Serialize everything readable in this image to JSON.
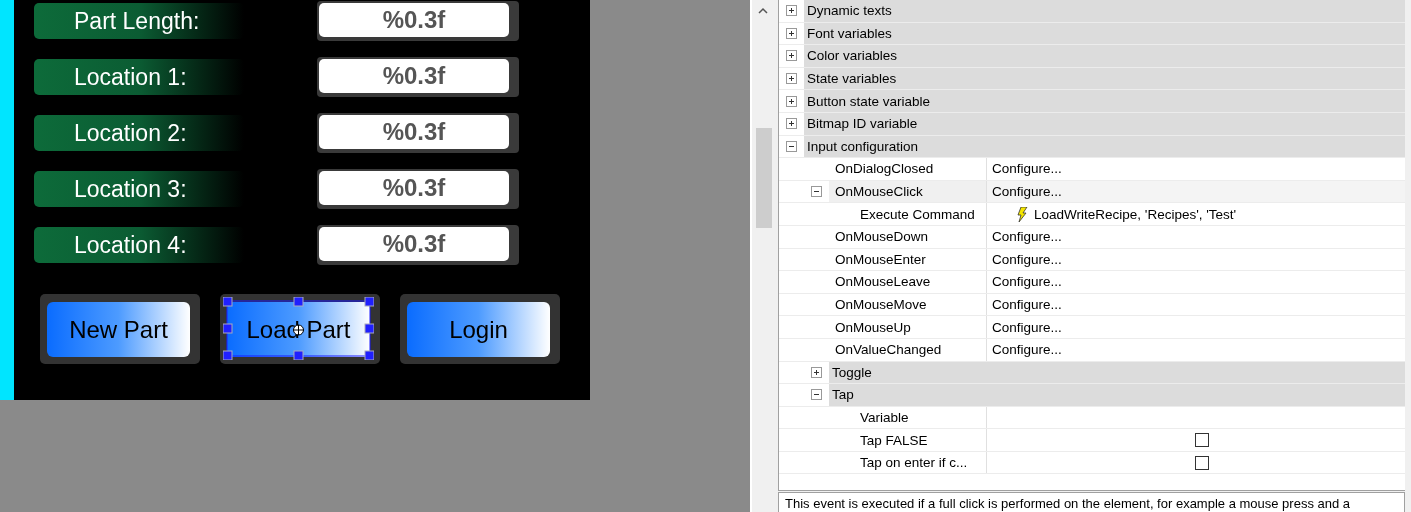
{
  "form": {
    "rows": [
      {
        "label": "Part Length:",
        "value": "%0.3f"
      },
      {
        "label": "Location 1:",
        "value": "%0.3f"
      },
      {
        "label": "Location 2:",
        "value": "%0.3f"
      },
      {
        "label": "Location 3:",
        "value": "%0.3f"
      },
      {
        "label": "Location 4:",
        "value": "%0.3f"
      }
    ],
    "buttons": [
      {
        "label": "New Part",
        "selected": false
      },
      {
        "label": "Load Part",
        "selected": true
      },
      {
        "label": "Login",
        "selected": false
      }
    ]
  },
  "properties": [
    {
      "kind": "category",
      "label": "Dynamic texts",
      "expanded": false
    },
    {
      "kind": "category",
      "label": "Font variables",
      "expanded": false
    },
    {
      "kind": "category",
      "label": "Color variables",
      "expanded": false
    },
    {
      "kind": "category",
      "label": "State variables",
      "expanded": false
    },
    {
      "kind": "category",
      "label": "Button state variable",
      "expanded": false
    },
    {
      "kind": "category",
      "label": "Bitmap ID variable",
      "expanded": false
    },
    {
      "kind": "category",
      "label": "Input configuration",
      "expanded": true,
      "children": [
        {
          "kind": "property",
          "name": "OnDialogClosed",
          "value": "Configure..."
        },
        {
          "kind": "property",
          "name": "OnMouseClick",
          "value": "Configure...",
          "expanded": true,
          "children": [
            {
              "kind": "command",
              "name": "Execute Command",
              "value": "LoadWriteRecipe, 'Recipes', 'Test'"
            }
          ]
        },
        {
          "kind": "property",
          "name": "OnMouseDown",
          "value": "Configure..."
        },
        {
          "kind": "property",
          "name": "OnMouseEnter",
          "value": "Configure..."
        },
        {
          "kind": "property",
          "name": "OnMouseLeave",
          "value": "Configure..."
        },
        {
          "kind": "property",
          "name": "OnMouseMove",
          "value": "Configure..."
        },
        {
          "kind": "property",
          "name": "OnMouseUp",
          "value": "Configure..."
        },
        {
          "kind": "property",
          "name": "OnValueChanged",
          "value": "Configure..."
        },
        {
          "kind": "category",
          "label": "Toggle",
          "expanded": false
        },
        {
          "kind": "category",
          "label": "Tap",
          "expanded": true,
          "children": [
            {
              "kind": "property",
              "name": "Variable"
            },
            {
              "kind": "checkbox",
              "name": "Tap FALSE",
              "checked": false
            },
            {
              "kind": "checkbox",
              "name": "Tap on enter if c...",
              "checked": false
            }
          ]
        }
      ]
    }
  ],
  "description": "This event is executed if a full click is performed on the element, for example a mouse press and a"
}
